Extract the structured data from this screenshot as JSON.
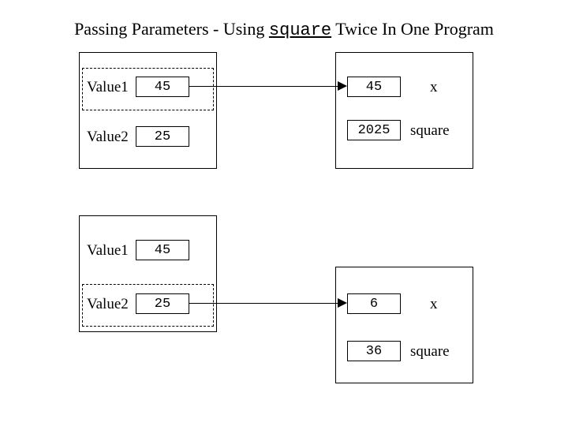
{
  "title": {
    "prefix": "Passing Parameters - Using ",
    "mono": "square",
    "suffix": " Twice In One Program"
  },
  "top": {
    "left": {
      "value1": {
        "label": "Value1",
        "value": "45"
      },
      "value2": {
        "label": "Value2",
        "value": "25"
      }
    },
    "right": {
      "x": {
        "label": "x",
        "value": "45"
      },
      "square": {
        "label": "square",
        "value": "2025"
      }
    }
  },
  "bottom": {
    "left": {
      "value1": {
        "label": "Value1",
        "value": "45"
      },
      "value2": {
        "label": "Value2",
        "value": "25"
      }
    },
    "right": {
      "x": {
        "label": "x",
        "value": "6"
      },
      "square": {
        "label": "square",
        "value": "36"
      }
    }
  }
}
